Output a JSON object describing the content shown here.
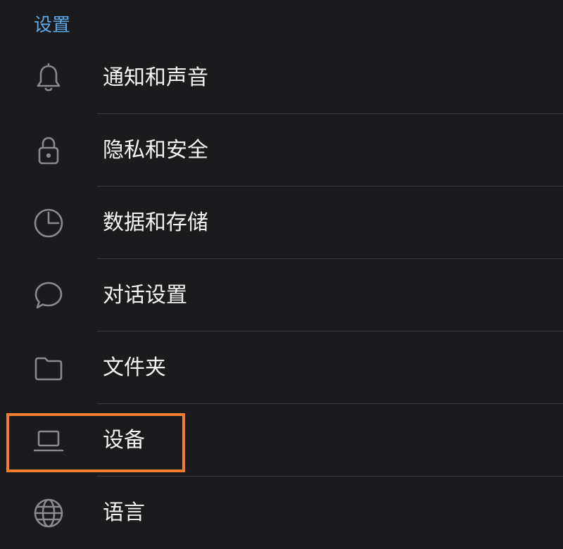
{
  "section_title": "设置",
  "highlight_color": "#f27c2e",
  "accent_color": "#5ea8e8",
  "menu": {
    "items": [
      {
        "label": "通知和声音",
        "icon": "bell-icon"
      },
      {
        "label": "隐私和安全",
        "icon": "lock-icon"
      },
      {
        "label": "数据和存储",
        "icon": "pie-chart-icon"
      },
      {
        "label": "对话设置",
        "icon": "chat-bubble-icon"
      },
      {
        "label": "文件夹",
        "icon": "folder-icon"
      },
      {
        "label": "设备",
        "icon": "laptop-icon"
      },
      {
        "label": "语言",
        "icon": "globe-icon"
      }
    ]
  }
}
